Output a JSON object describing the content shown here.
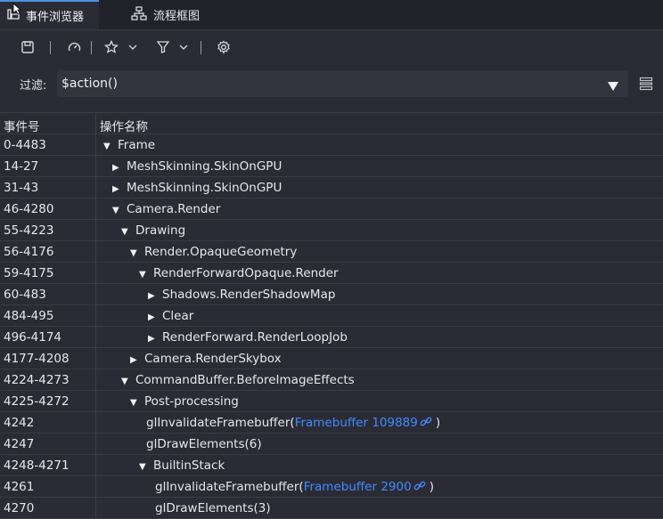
{
  "tabs": [
    {
      "label": "事件浏览器",
      "icon": "event-browser-icon",
      "active": true
    },
    {
      "label": "流程框图",
      "icon": "flowchart-icon",
      "active": false
    }
  ],
  "toolbar": {
    "icons": [
      "save-icon",
      "timer-icon",
      "star-icon",
      "chevron-down-icon",
      "filter-icon",
      "chevron-down-icon",
      "settings-icon"
    ]
  },
  "filter": {
    "label": "过滤:",
    "value": "$action()"
  },
  "table": {
    "headers": {
      "id": "事件号",
      "name": "操作名称"
    },
    "rows": [
      {
        "id": "0-4483",
        "tri": "▼",
        "name": "Frame",
        "depth": 0
      },
      {
        "id": "14-27",
        "tri": "▶",
        "name": "MeshSkinning.SkinOnGPU",
        "depth": 1
      },
      {
        "id": "31-43",
        "tri": "▶",
        "name": "MeshSkinning.SkinOnGPU",
        "depth": 1
      },
      {
        "id": "46-4280",
        "tri": "▼",
        "name": "Camera.Render",
        "depth": 1
      },
      {
        "id": "55-4223",
        "tri": "▼",
        "name": "Drawing",
        "depth": 2
      },
      {
        "id": "56-4176",
        "tri": "▼",
        "name": "Render.OpaqueGeometry",
        "depth": 3
      },
      {
        "id": "59-4175",
        "tri": "▼",
        "name": "RenderForwardOpaque.Render",
        "depth": 4
      },
      {
        "id": "60-483",
        "tri": "▶",
        "name": "Shadows.RenderShadowMap",
        "depth": 5
      },
      {
        "id": "484-495",
        "tri": "▶",
        "name": "Clear",
        "depth": 5
      },
      {
        "id": "496-4174",
        "tri": "▶",
        "name": "RenderForward.RenderLoopJob",
        "depth": 5
      },
      {
        "id": "4177-4208",
        "tri": "▶",
        "name": "Camera.RenderSkybox",
        "depth": 3
      },
      {
        "id": "4224-4273",
        "tri": "▼",
        "name": "CommandBuffer.BeforeImageEffects",
        "depth": 2
      },
      {
        "id": "4225-4272",
        "tri": "▼",
        "name": "Post-processing",
        "depth": 3
      },
      {
        "id": "4242",
        "tri": "",
        "name": "glInvalidateFramebuffer(",
        "link": "Framebuffer 109889",
        "suffix": ")",
        "depth": 4
      },
      {
        "id": "4247",
        "tri": "",
        "name": "glDrawElements(6)",
        "depth": 4
      },
      {
        "id": "4248-4271",
        "tri": "▼",
        "name": "BuiltinStack",
        "depth": 4
      },
      {
        "id": "4261",
        "tri": "",
        "name": "glInvalidateFramebuffer(",
        "link": "Framebuffer 2900",
        "suffix": ")",
        "depth": 5
      },
      {
        "id": "4270",
        "tri": "",
        "name": "glDrawElements(3)",
        "depth": 5
      }
    ]
  },
  "colors": {
    "accent": "#4a90e2",
    "link": "#3f8cff",
    "background": "#2b2b35"
  }
}
